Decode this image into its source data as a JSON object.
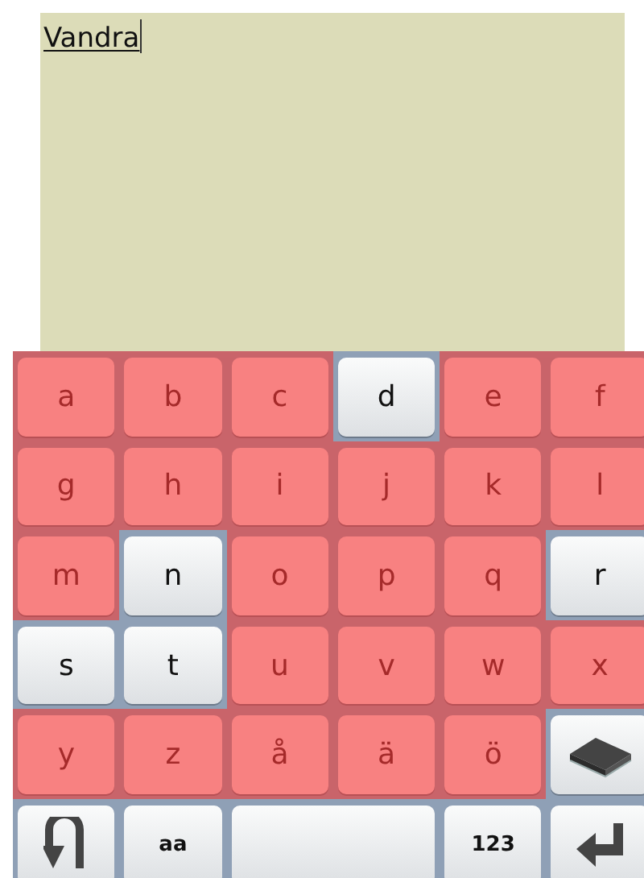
{
  "editor": {
    "text": "Vandra",
    "composing": true
  },
  "keyboard": {
    "rows": [
      {
        "keys": [
          {
            "kind": "letter",
            "label": "a",
            "enabled": false
          },
          {
            "kind": "letter",
            "label": "b",
            "enabled": false
          },
          {
            "kind": "letter",
            "label": "c",
            "enabled": false
          },
          {
            "kind": "letter",
            "label": "d",
            "enabled": true
          },
          {
            "kind": "letter",
            "label": "e",
            "enabled": false
          },
          {
            "kind": "letter",
            "label": "f",
            "enabled": false
          }
        ]
      },
      {
        "keys": [
          {
            "kind": "letter",
            "label": "g",
            "enabled": false
          },
          {
            "kind": "letter",
            "label": "h",
            "enabled": false
          },
          {
            "kind": "letter",
            "label": "i",
            "enabled": false
          },
          {
            "kind": "letter",
            "label": "j",
            "enabled": false
          },
          {
            "kind": "letter",
            "label": "k",
            "enabled": false
          },
          {
            "kind": "letter",
            "label": "l",
            "enabled": false
          }
        ]
      },
      {
        "keys": [
          {
            "kind": "letter",
            "label": "m",
            "enabled": false
          },
          {
            "kind": "letter",
            "label": "n",
            "enabled": true
          },
          {
            "kind": "letter",
            "label": "o",
            "enabled": false
          },
          {
            "kind": "letter",
            "label": "p",
            "enabled": false
          },
          {
            "kind": "letter",
            "label": "q",
            "enabled": false
          },
          {
            "kind": "letter",
            "label": "r",
            "enabled": true
          }
        ]
      },
      {
        "keys": [
          {
            "kind": "letter",
            "label": "s",
            "enabled": true
          },
          {
            "kind": "letter",
            "label": "t",
            "enabled": true
          },
          {
            "kind": "letter",
            "label": "u",
            "enabled": false
          },
          {
            "kind": "letter",
            "label": "v",
            "enabled": false
          },
          {
            "kind": "letter",
            "label": "w",
            "enabled": false
          },
          {
            "kind": "letter",
            "label": "x",
            "enabled": false
          }
        ]
      },
      {
        "keys": [
          {
            "kind": "letter",
            "label": "y",
            "enabled": false
          },
          {
            "kind": "letter",
            "label": "z",
            "enabled": false
          },
          {
            "kind": "letter",
            "label": "å",
            "enabled": false
          },
          {
            "kind": "letter",
            "label": "ä",
            "enabled": false
          },
          {
            "kind": "letter",
            "label": "ö",
            "enabled": false
          },
          {
            "kind": "eraser"
          }
        ]
      },
      {
        "keys": [
          {
            "kind": "undo"
          },
          {
            "kind": "mode",
            "label": "aa"
          },
          {
            "kind": "space"
          },
          {
            "kind": "mode",
            "label": "123"
          },
          {
            "kind": "enter"
          }
        ]
      }
    ]
  }
}
